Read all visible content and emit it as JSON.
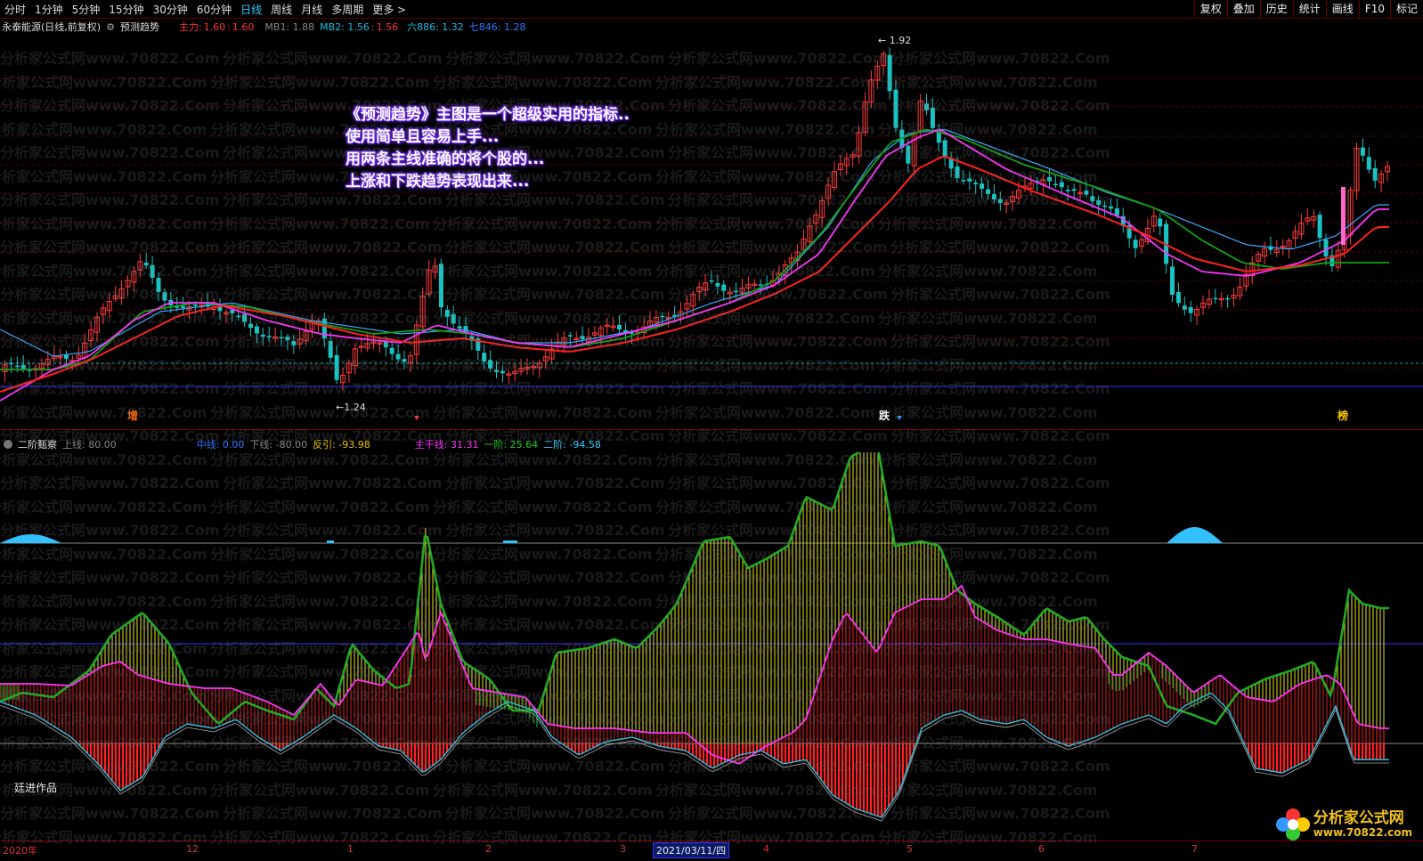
{
  "toolbar": {
    "timeframes": [
      "分时",
      "1分钟",
      "5分钟",
      "15分钟",
      "30分钟",
      "60分钟",
      "日线",
      "周线",
      "月线",
      "多周期",
      "更多 >"
    ],
    "active": "日线",
    "tools": [
      "复权",
      "叠加",
      "历史",
      "统计",
      "画线",
      "F10",
      "标记"
    ]
  },
  "info": {
    "stock": "永泰能源(日线,前复权)",
    "indicator": "预测趋势",
    "main_label": "主力:",
    "main_v1": "1.60",
    "main_v2": "1.60",
    "mb1": "MB1: 1.88",
    "mb2": "MB2: 1.56",
    "mb2_v2": "1.56",
    "six": "六886: 1.32",
    "seven": "七846: 1.28"
  },
  "price_labels": {
    "high": "1.92",
    "low": "1.24"
  },
  "signals": {
    "zeng": "增",
    "die": "跌",
    "bang": "榜"
  },
  "annotation": [
    "《预测趋势》主图是一个超级实用的指标..",
    "使用简单且容易上手...",
    "用两条主线准确的将个股的...",
    "上涨和下跌趋势表现出来..."
  ],
  "indicator": {
    "name": "二阶甄察",
    "upper": "上线: 80.00",
    "middle": "中线: 0.00",
    "lower": "下线: -80.00",
    "reverse": "反引: -93.98",
    "trunk": "主干线: 31.31",
    "first": "一阶: 25.64",
    "second": "二阶: -94.58"
  },
  "watermark": "分析家公式网www.70822.Com",
  "signature": "廷进作品",
  "logo": {
    "title": "分析家公式网",
    "url": "www.70822.com"
  },
  "dates": {
    "year": "2020年",
    "m12": "12",
    "m1": "1",
    "m2": "2",
    "m3": "3",
    "cursor": "2021/03/11/四",
    "m4": "4",
    "m5": "5",
    "m6": "6",
    "m7": "7"
  },
  "colors": {
    "up": "#ff3b3b",
    "down": "#19c3c3",
    "ma_red": "#ff2020",
    "ma_magenta": "#ff33ff",
    "ma_green": "#12a012",
    "ma_blue": "#3aa8ff"
  }
}
